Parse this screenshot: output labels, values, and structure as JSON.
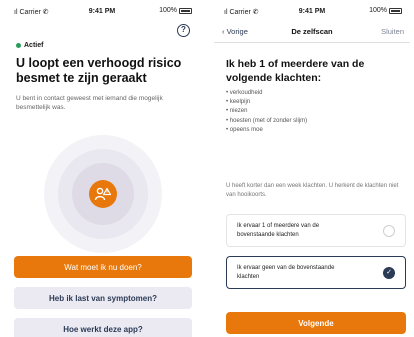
{
  "status_bar": {
    "carrier": "ıl Carrier ✆",
    "time": "9:41 PM",
    "battery": "100%"
  },
  "left": {
    "status": "Actief",
    "help_icon": "?",
    "title": "U loopt een verhoogd risico besmet te zijn geraakt",
    "body": "U bent in contact geweest met iemand die mogelijk besmettelijk was.",
    "buttons": {
      "what_now": "Wat moet ik nu doen?",
      "symptoms": "Heb ik last van symptomen?",
      "how_works": "Hoe werkt deze app?"
    },
    "colors": {
      "accent": "#e8780b",
      "status_dot": "#2a9d5a",
      "secondary_bg": "#ebeaf3"
    }
  },
  "right": {
    "nav": {
      "back": "Vorige",
      "title": "De zelfscan",
      "close": "Sluiten"
    },
    "question": "Ik heb 1 of meerdere van de volgende klachten:",
    "symptoms": [
      "verkoudheid",
      "keelpijn",
      "niezen",
      "hoesten (met of zonder slijm)",
      "opeens moe"
    ],
    "note": "U heeft korter dan een week klachten. U herkent de klachten niet van hooikoorts.",
    "options": [
      {
        "label": "Ik ervaar 1 of meerdere van de bovenstaande klachten",
        "selected": false
      },
      {
        "label": "Ik ervaar geen van de bovenstaande klachten",
        "selected": true
      }
    ],
    "next_button": "Volgende",
    "colors": {
      "primary": "#2b3a55"
    }
  }
}
